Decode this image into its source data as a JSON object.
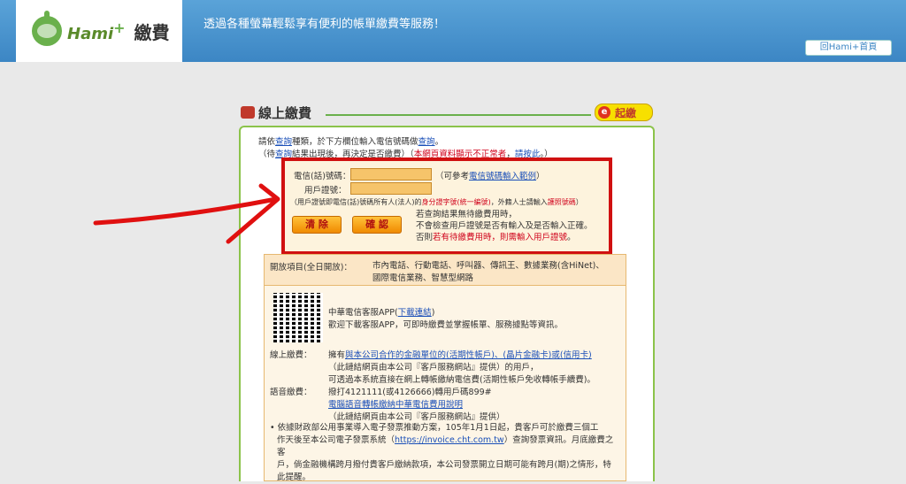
{
  "header": {
    "brand": "Hami",
    "brand_plus": "+",
    "brand_fee": "繳費",
    "tagline": "透過各種螢幕輕鬆享有便利的帳單繳費等服務！",
    "home_button": "回Hami+首頁"
  },
  "card": {
    "title": "線上繳費",
    "start_label": "起繳",
    "start_prefix": "e",
    "intro_line1_a": "請依",
    "intro_line1_link1": "查詢",
    "intro_line1_b": "種類，於下方欄位輸入電信號碼做",
    "intro_line1_link2": "查詢",
    "intro_line1_c": "。",
    "intro_line2_a": "（待",
    "intro_line2_link": "查詢",
    "intro_line2_b": "結果出現後，再決定是否繳費）（",
    "intro_line2_red": "本網頁資料顯示不正常者",
    "intro_line2_c": "，",
    "intro_line2_link2": "請按此",
    "intro_line2_d": "。）"
  },
  "form": {
    "phone_label": "電信(話)號碼：",
    "phone_hint_a": "（可參考",
    "phone_hint_link": "電信號碼輸入範例",
    "phone_hint_b": "）",
    "id_label": "用戶證號：",
    "note_a": "（用戶證號即電信(話)號碼所有人(法人)的",
    "note_red1": "身分證字號(統一編號)",
    "note_b": "，外籍人士請輸入",
    "note_red2": "護照號碼",
    "note_c": "）",
    "clear_button": "清 除",
    "confirm_button": "確 認",
    "side_line1": "若查詢結果無待繳費用時，",
    "side_line2": "不會檢查用戶證號是否有輸入及是否輸入正確。",
    "side_line3_a": "否則",
    "side_line3_red": "若有待繳費用時，則需輸入用戶證號",
    "side_line3_b": "。"
  },
  "open": {
    "label": "開放項目(全日開放)：",
    "items_line1": "市內電話、行動電話、呼叫器、傳訊王、數據業務(含HiNet)、",
    "items_line2": "國際電信業務、智慧型網路"
  },
  "info": {
    "app_line1_a": "中華電信客服APP(",
    "app_link": "下載連結",
    "app_line1_b": ")",
    "app_line2": "歡迎下載客服APP，可即時繳費並掌握帳單、服務據點等資訊。",
    "online_label": "線上繳費：",
    "online_line1_a": "擁有",
    "online_link": "與本公司合作的金融單位的(活期性帳戶)、(晶片金融卡)或(信用卡)",
    "online_line2": "（此鏈結網頁由本公司『客戶服務網站』提供）的用戶，",
    "online_line3": "可透過本系統直接在網上轉帳繳納電信費(活期性帳戶免收轉帳手續費)。",
    "voice_label": "語音繳費：",
    "voice_line1": "撥打4121111(或4126666)轉用戶碼899#",
    "voice_link": "電腦語音轉帳繳納中華電信費用說明",
    "voice_line3": "（此鏈結網頁由本公司『客戶服務網站』提供）",
    "bullet_line1": "依據財政部公用事業導入電子發票推動方案，105年1月1日起，貴客戶可於繳費三個工",
    "bullet_line2_a": "作天後至本公司電子發票系統（",
    "bullet_link": "https://invoice.cht.com.tw",
    "bullet_line2_b": "）查詢發票資訊。月底繳費之客",
    "bullet_line3": "戶，倘金融機構跨月撥付貴客戶繳納款項，本公司發票開立日期可能有跨月(期)之情形，特",
    "bullet_line4": "此提醒。"
  },
  "colors": {
    "header": "#3c86c4",
    "accent_green": "#8bc34a",
    "alert_red": "#d01010",
    "button_orange": "#f08a00"
  }
}
